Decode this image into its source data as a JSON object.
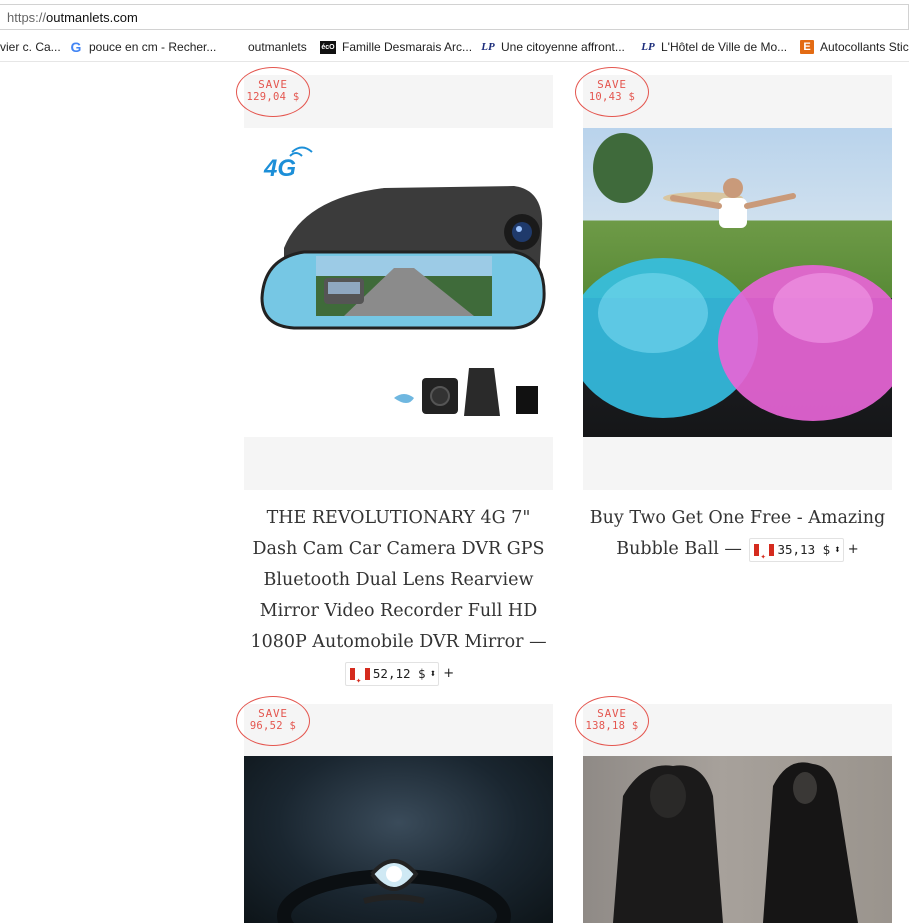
{
  "browser": {
    "url_scheme": "https://",
    "url_host": "outmanlets.com",
    "bookmarks": [
      {
        "label": "vier c. Ca...",
        "icon": "none"
      },
      {
        "label": "pouce en cm - Recher...",
        "icon": "G"
      },
      {
        "label": "outmanlets",
        "icon": "none"
      },
      {
        "label": "Famille Desmarais Arc...",
        "icon": "écO"
      },
      {
        "label": "Une citoyenne affront...",
        "icon": "LP"
      },
      {
        "label": "L'Hôtel de Ville de Mo...",
        "icon": "LP"
      },
      {
        "label": "Autocollants Stic",
        "icon": "E"
      }
    ]
  },
  "products": [
    {
      "badge_label": "SAVE",
      "badge_amount": "129,04 $",
      "title": "THE REVOLUTIONARY 4G 7\" Dash Cam Car Camera DVR GPS Bluetooth Dual Lens Rearview Mirror Video Recorder Full HD 1080P Automobile DVR Mirror",
      "dash": "—",
      "price": "52,12 $",
      "plus": "+",
      "image_text": "4G"
    },
    {
      "badge_label": "SAVE",
      "badge_amount": "10,43 $",
      "title": "Buy Two Get One Free - Amazing Bubble Ball",
      "dash": "—",
      "price": "35,13 $",
      "plus": "+"
    },
    {
      "badge_label": "SAVE",
      "badge_amount": "96,52 $"
    },
    {
      "badge_label": "SAVE",
      "badge_amount": "138,18 $"
    }
  ],
  "colors": {
    "accent": "#e4564f",
    "card_bg": "#f5f5f5",
    "text": "#333333"
  }
}
